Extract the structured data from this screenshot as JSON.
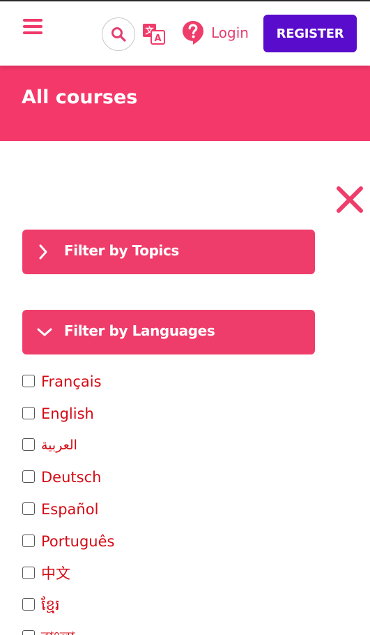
{
  "header": {
    "menu_icon": "hamburger-menu-icon",
    "search_icon": "search-icon",
    "translate_icon": "translate-icon",
    "help_icon": "question-circle-icon",
    "login_label": "Login",
    "register_label": "REGISTER"
  },
  "banner": {
    "title": "All courses"
  },
  "filters": {
    "close_icon": "close-x-icon",
    "topics": {
      "label": "Filter by Topics",
      "state": "collapsed",
      "icon": "chevron-right-icon"
    },
    "languages": {
      "label": "Filter by Languages",
      "state": "expanded",
      "icon": "chevron-down-icon"
    }
  },
  "languages": [
    {
      "label": "Français",
      "checked": false
    },
    {
      "label": "English",
      "checked": false
    },
    {
      "label": "العربية",
      "checked": false
    },
    {
      "label": "Deutsch",
      "checked": false
    },
    {
      "label": "Español",
      "checked": false
    },
    {
      "label": "Português",
      "checked": false
    },
    {
      "label": "中文",
      "checked": false
    },
    {
      "label": "ខ្មែរ",
      "checked": false
    },
    {
      "label": "বাংলা",
      "checked": false
    }
  ],
  "colors": {
    "brand_pink": "#f5386a",
    "register_purple": "#5a0ccc",
    "language_text": "#d40a14"
  }
}
